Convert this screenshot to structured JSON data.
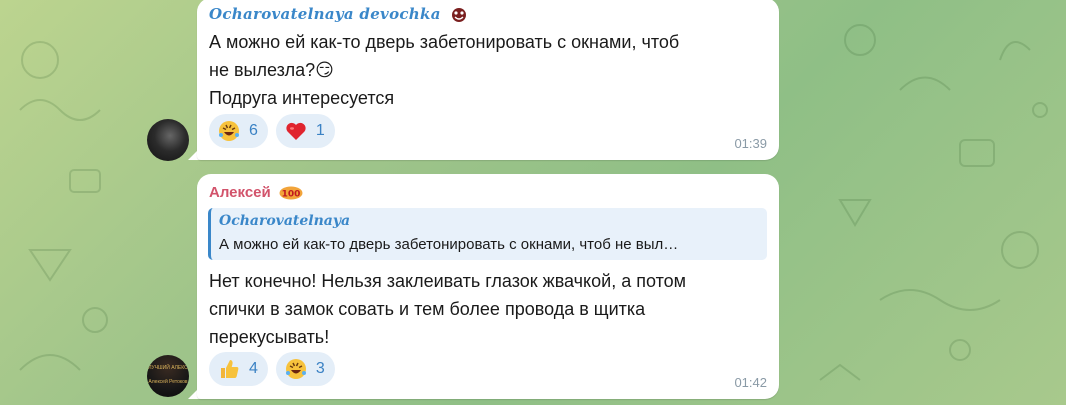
{
  "messages": [
    {
      "sender": "Ocharovatelnaya devochka",
      "text_lines": [
        "А можно ей как-то дверь забетонировать с окнами, чтоб",
        "не вылезла?😏",
        "Подруга интересуется"
      ],
      "reactions": [
        {
          "icon": "rofl-emoji",
          "count": "6"
        },
        {
          "icon": "heart-emoji",
          "count": "1"
        }
      ],
      "time": "01:39"
    },
    {
      "sender": "Алексей",
      "reply": {
        "sender": "Ocharovatelnaya",
        "text": "А можно ей как-то дверь забетонировать с окнами, чтоб не выл…"
      },
      "text_lines": [
        "Нет конечно! Нельзя заклеивать глазок жвачкой, а потом",
        "спички в замок совать и тем более провода в щитка",
        "перекусывать!"
      ],
      "reactions": [
        {
          "icon": "thumbs-up-emoji",
          "count": "4"
        },
        {
          "icon": "rofl-emoji",
          "count": "3"
        }
      ],
      "time": "01:42"
    }
  ],
  "avatars": {
    "second_caption_lines": [
      "ЛУЧШИЙ АЛЕКС",
      "Алексей Ретоков"
    ]
  },
  "colors": {
    "link_blue": "#3a87c9",
    "sender_pink": "#d2536b",
    "reaction_bg": "#e4eef8",
    "reaction_count": "#3b82c4",
    "time_gray": "#8a9aa6",
    "wallpaper": "#9fc48a"
  }
}
